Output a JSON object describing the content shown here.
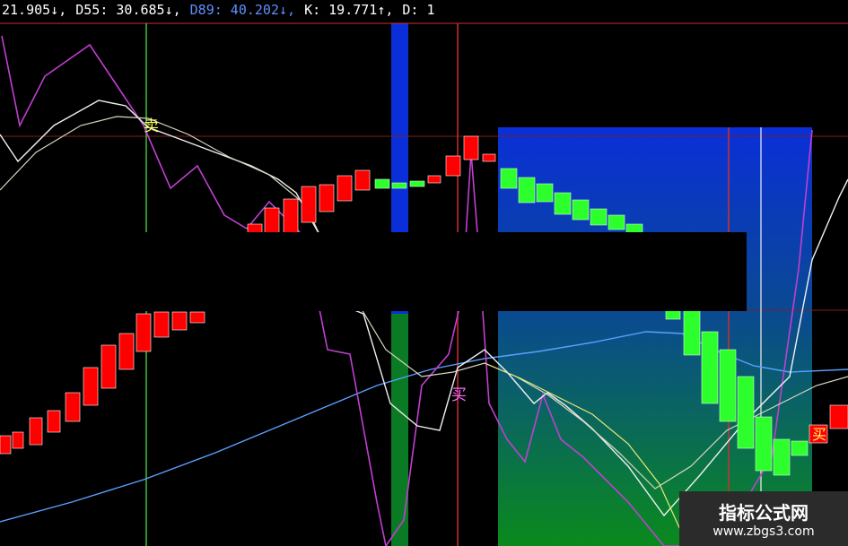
{
  "indicators": [
    {
      "text": "21.905↓,",
      "color": "#ffffff"
    },
    {
      "text": "D55: 30.685↓,",
      "color": "#ffffff"
    },
    {
      "text": "D89: 40.202↓,",
      "color": "#5f8fff"
    },
    {
      "text": "K: 19.771↑,",
      "color": "#ffffff"
    },
    {
      "text": "D: 1",
      "color": "#ffffff"
    }
  ],
  "signals": {
    "sell": "卖",
    "buy": "买"
  },
  "watermark": {
    "title": "指标公式网",
    "url": "www.zbgs3.com"
  },
  "colors": {
    "bg": "#000000",
    "up_candle": "#ff0000",
    "down_candle": "#00ff00",
    "zone_blue": "#0a2fd8",
    "zone_green": "#0a7a24",
    "line_white": "#f0f0f0",
    "line_yellow": "#e8e87a",
    "line_magenta": "#c040d0",
    "line_blue": "#5aa0ff",
    "ref_red": "#cc3030",
    "ref_green": "#40c040"
  }
}
